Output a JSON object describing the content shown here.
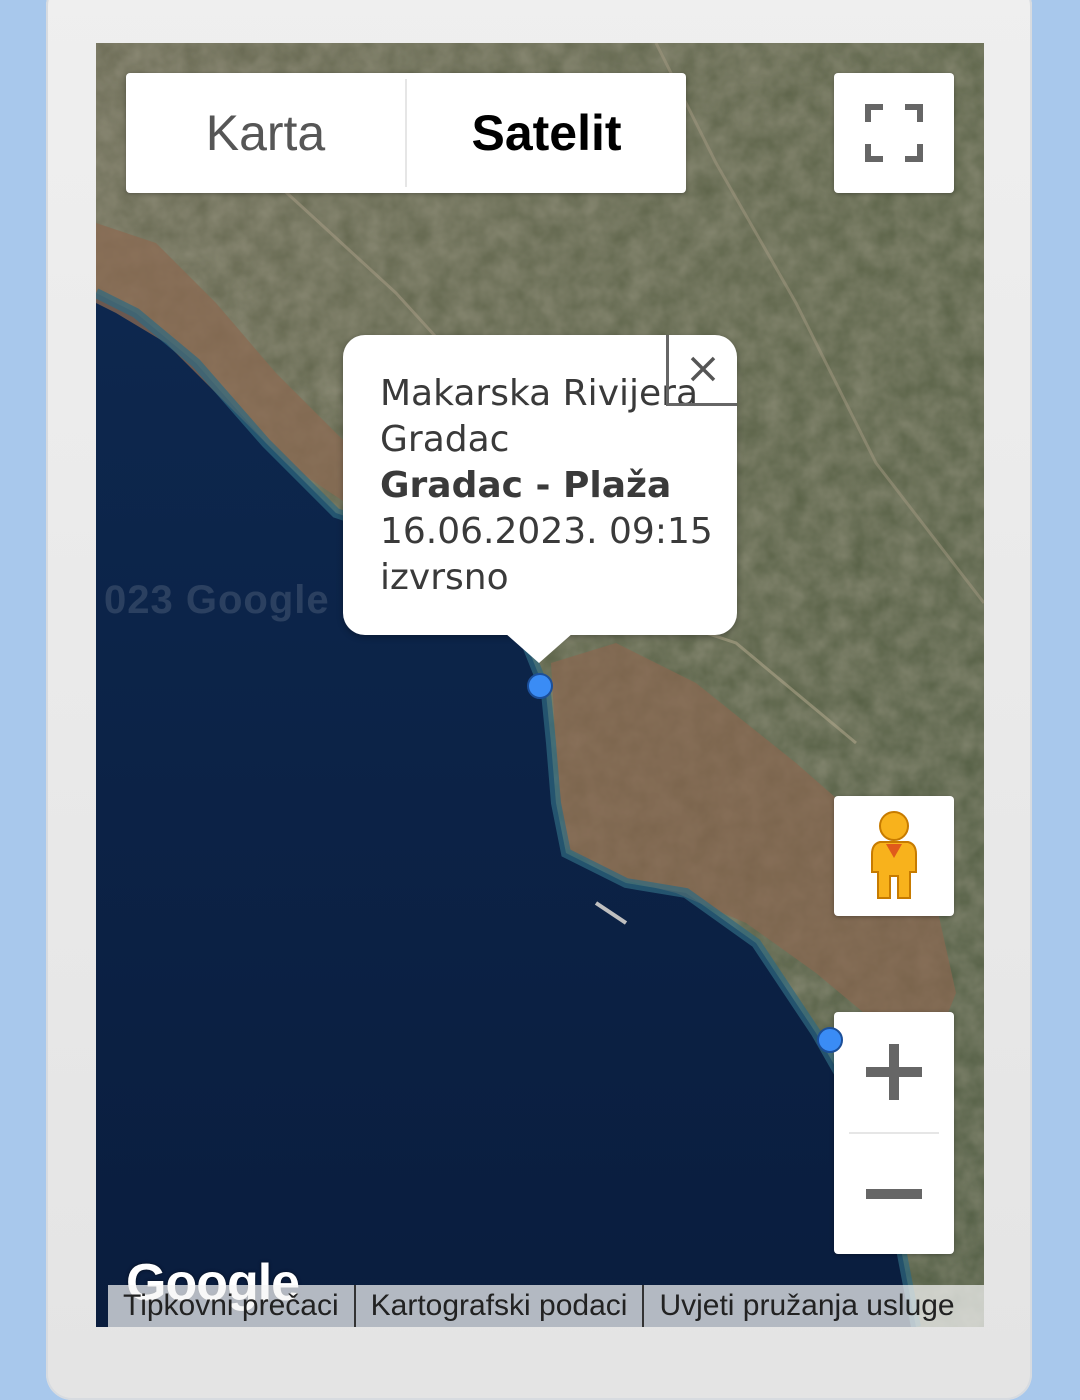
{
  "map_type": {
    "options": [
      "Karta",
      "Satelit"
    ],
    "selected": "Satelit"
  },
  "controls": {
    "fullscreen_icon": "fullscreen-icon",
    "pegman_icon": "street-view-pegman-icon",
    "zoom_in_icon": "plus-icon",
    "zoom_out_icon": "minus-icon"
  },
  "watermark": "023 Google",
  "info_window": {
    "region": "Makarska Rivijera",
    "town": "Gradac",
    "location": "Gradac - Plaža",
    "datetime": "16.06.2023. 09:15",
    "rating": "izvrsno",
    "close_icon": "close-icon"
  },
  "logo": "Google",
  "footer": {
    "shortcuts": "Tipkovni prečaci",
    "map_data": "Kartografski podaci",
    "terms": "Uvjeti pružanja usluge"
  },
  "colors": {
    "marker": "#3a8cf5",
    "sea": "#0d2447",
    "page_background": "#a8c8ec"
  }
}
